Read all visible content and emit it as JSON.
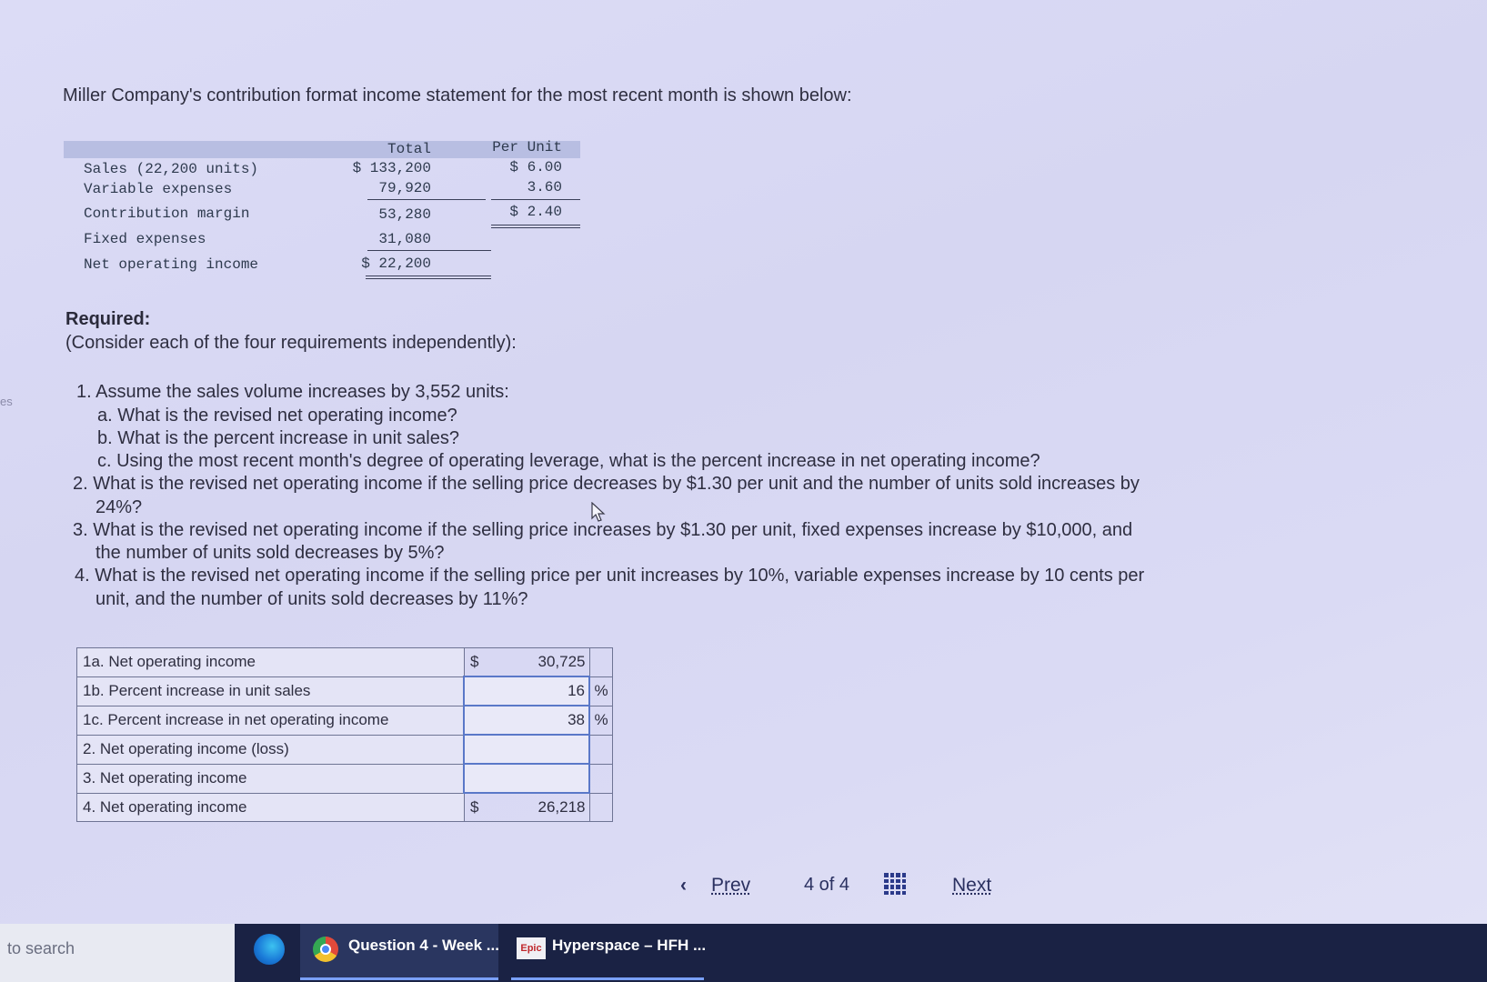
{
  "side_tab": "es",
  "intro": "Miller Company's contribution format income statement for the most recent month is shown below:",
  "statement": {
    "headers": {
      "total": "Total",
      "per_unit": "Per Unit"
    },
    "rows": [
      {
        "label": "Sales (22,200 units)",
        "total": "$ 133,200",
        "per_unit": "$ 6.00"
      },
      {
        "label": "Variable expenses",
        "total": "79,920",
        "per_unit": "3.60"
      },
      {
        "label": "Contribution margin",
        "total": "53,280",
        "per_unit": "$ 2.40"
      },
      {
        "label": "Fixed expenses",
        "total": "31,080",
        "per_unit": ""
      },
      {
        "label": "Net operating income",
        "total": "$ 22,200",
        "per_unit": ""
      }
    ]
  },
  "required": {
    "heading": "Required:",
    "note": "(Consider each of the four requirements independently):"
  },
  "questions": {
    "q1": "1. Assume the sales volume increases by 3,552 units:",
    "q1a": "a. What is the revised net operating income?",
    "q1b": "b. What is the percent increase in unit sales?",
    "q1c": "c. Using the most recent month's degree of operating leverage, what is the percent increase in net operating income?",
    "q2_line1": "2. What is the revised net operating income if the selling price decreases by $1.30 per unit and the number of units sold increases by",
    "q2_line2": "24%?",
    "q3_line1": "3. What is the revised net operating income if the selling price increases by $1.30 per unit, fixed expenses increase by $10,000, and",
    "q3_line2": "the number of units sold decreases by 5%?",
    "q4_line1": "4. What is the revised net operating income if the selling price per unit increases by 10%, variable expenses increase by 10 cents per",
    "q4_line2": "unit, and the number of units sold decreases by 11%?"
  },
  "answers": [
    {
      "label": "1a. Net operating income",
      "currency": "$",
      "value": "30,725",
      "unit": ""
    },
    {
      "label": "1b. Percent increase in unit sales",
      "currency": "",
      "value": "16",
      "unit": "%"
    },
    {
      "label": "1c. Percent increase in net operating income",
      "currency": "",
      "value": "38",
      "unit": "%"
    },
    {
      "label": "2. Net operating income (loss)",
      "currency": "",
      "value": "",
      "unit": ""
    },
    {
      "label": "3. Net operating income",
      "currency": "",
      "value": "",
      "unit": ""
    },
    {
      "label": "4. Net operating income",
      "currency": "$",
      "value": "26,218",
      "unit": ""
    }
  ],
  "navigation": {
    "prev_label": "Prev",
    "position": "4 of 4",
    "next_label": "Next"
  },
  "taskbar": {
    "search_placeholder": "to search",
    "items": [
      "Question 4 - Week ...",
      "Hyperspace – HFH ..."
    ],
    "epic_badge": "Epic"
  },
  "icons": [
    "chevron-left-icon",
    "grid-icon",
    "edge-icon",
    "chrome-icon",
    "epic-icon"
  ],
  "colors": {
    "header_band": "#b8bee2",
    "input_border": "#5a78c8",
    "taskbar": "#1a2244",
    "nav_text": "#2a3060"
  }
}
